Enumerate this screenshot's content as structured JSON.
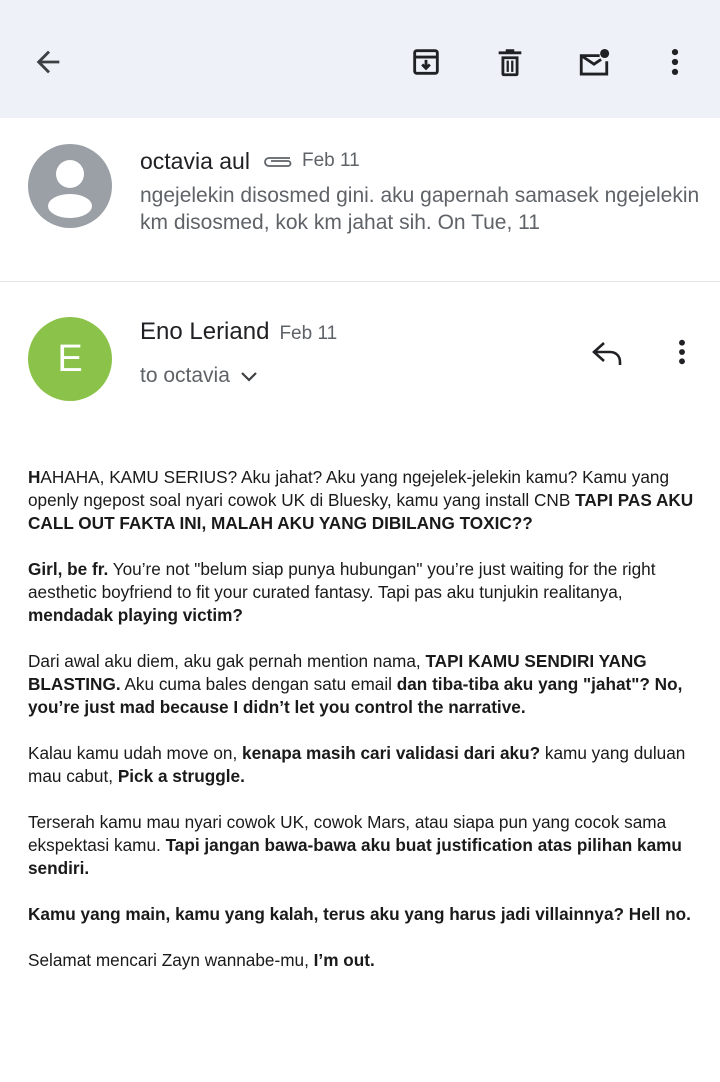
{
  "toolbar": {
    "back_icon": "arrow-left-icon",
    "archive_icon": "archive-icon",
    "delete_icon": "trash-icon",
    "mark_unread_icon": "mail-unread-icon",
    "more_icon": "more-vert-icon"
  },
  "collapsed_message": {
    "sender": "octavia aul",
    "date": "Feb 11",
    "has_attachment": true,
    "snippet": "ngejelekin disosmed gini. aku gapernah samasek ngejelekin km disosmed, kok km jahat sih. On Tue, 11"
  },
  "expanded_message": {
    "avatar_letter": "E",
    "sender": "Eno Leriand",
    "date": "Feb 11",
    "recipient": "to octavia",
    "body": {
      "p1": {
        "a": "H",
        "b": "AHAHA, KAMU SERIUS? Aku jahat? Aku yang ngejelek-jelekin kamu? Kamu yang openly ngepost soal nyari cowok UK di Bluesky, kamu yang install CNB ",
        "c": "TAPI PAS AKU CALL OUT FAKTA INI, MALAH AKU YANG DIBILANG TOXIC??"
      },
      "p2": {
        "a": "Girl, be fr.",
        "b": " You’re not \"belum siap punya hubungan\" you’re just waiting for the right aesthetic boyfriend to fit your curated fantasy. Tapi pas aku tunjukin realitanya, ",
        "c": "mendadak playing victim?"
      },
      "p3": {
        "a": "Dari awal aku diem, aku gak pernah mention nama, ",
        "b": "TAPI KAMU SENDIRI YANG BLASTING.",
        "c": " Aku cuma bales dengan satu email ",
        "d": "dan tiba-tiba aku yang \"jahat\"? No, you’re just mad because I didn’t let you control the narrative."
      },
      "p4": {
        "a": "Kalau kamu udah move on, ",
        "b": "kenapa masih cari validasi dari aku?",
        "c": " kamu yang duluan mau cabut, ",
        "d": "Pick a struggle."
      },
      "p5": {
        "a": "Terserah kamu mau nyari cowok UK, cowok Mars, atau siapa pun yang cocok sama ekspektasi kamu. ",
        "b": "Tapi jangan bawa-bawa aku buat justification atas pilihan kamu sendiri."
      },
      "p6": {
        "a": "Kamu yang main, kamu yang kalah, terus aku yang harus jadi villainnya? Hell no."
      },
      "p7": {
        "a": "Selamat mencari Zayn wannabe-mu, ",
        "b": "I’m out."
      }
    }
  },
  "colors": {
    "toolbar_bg": "#eef2f8",
    "avatar_default": "#9aa0a6",
    "avatar_e": "#8bc34a",
    "secondary_text": "#5f6368"
  }
}
